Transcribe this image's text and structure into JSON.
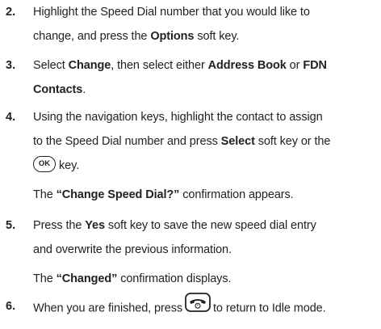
{
  "steps": [
    {
      "number": "2.",
      "line1_pre": "Highlight the Speed Dial number that you would like to",
      "line2_pre": "change, and press the ",
      "line2_bold": "Options",
      "line2_post": " soft key."
    },
    {
      "number": "3.",
      "line1_pre": "Select ",
      "line1_bold1": "Change",
      "line1_mid": ", then select either ",
      "line1_bold2": "Address Book",
      "line1_mid2": " or ",
      "line1_bold3": "FDN",
      "line2_bold": "Contacts",
      "line2_post": "."
    },
    {
      "number": "4.",
      "line1": "Using the navigation keys, highlight the contact to assign",
      "line2_pre": "to the Speed Dial number and press ",
      "line2_bold": "Select",
      "line2_post": " soft key or the",
      "ok_icon_text": "OK",
      "line3_post": "key.",
      "note_pre": "The ",
      "note_bold": "“Change Speed Dial?”",
      "note_post": " confirmation appears."
    },
    {
      "number": "5.",
      "line1_pre": "Press the ",
      "line1_bold": "Yes",
      "line1_post": " soft key to save the new speed dial entry",
      "line2": "and overwrite the previous information.",
      "note_pre": "The ",
      "note_bold": "“Changed”",
      "note_post": " confirmation displays."
    },
    {
      "number": "6.",
      "line1_pre": "When you are finished, press",
      "end_icon": "end-key-icon",
      "line1_post": "to return to Idle mode."
    }
  ]
}
